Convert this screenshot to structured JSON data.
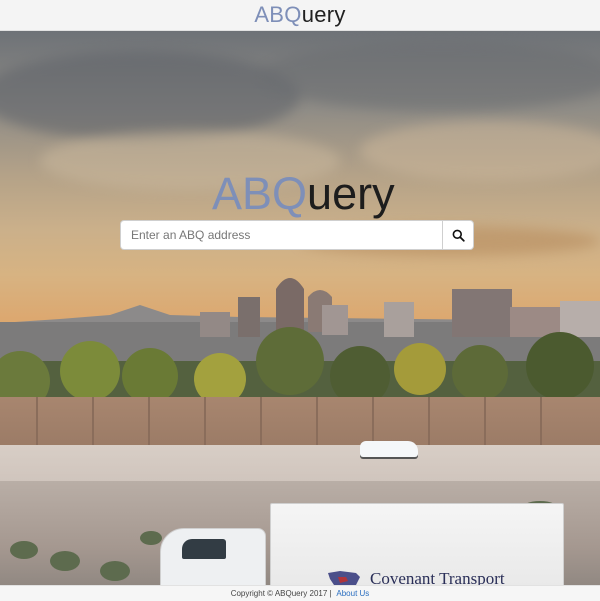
{
  "header": {
    "logo_prefix": "ABQ",
    "logo_suffix": "uery"
  },
  "hero": {
    "logo_prefix": "ABQ",
    "logo_suffix": "uery",
    "truck_text": "Covenant Transport"
  },
  "search": {
    "placeholder": "Enter an ABQ address",
    "value": "",
    "button_icon": "search-icon"
  },
  "footer": {
    "copyright": "Copyright © ABQuery 2017",
    "separator": "|",
    "about_link": "About Us"
  },
  "colors": {
    "brand_blue": "#7e8fb8",
    "text_dark": "#1d1d1d",
    "link_blue": "#2a6ec0"
  }
}
